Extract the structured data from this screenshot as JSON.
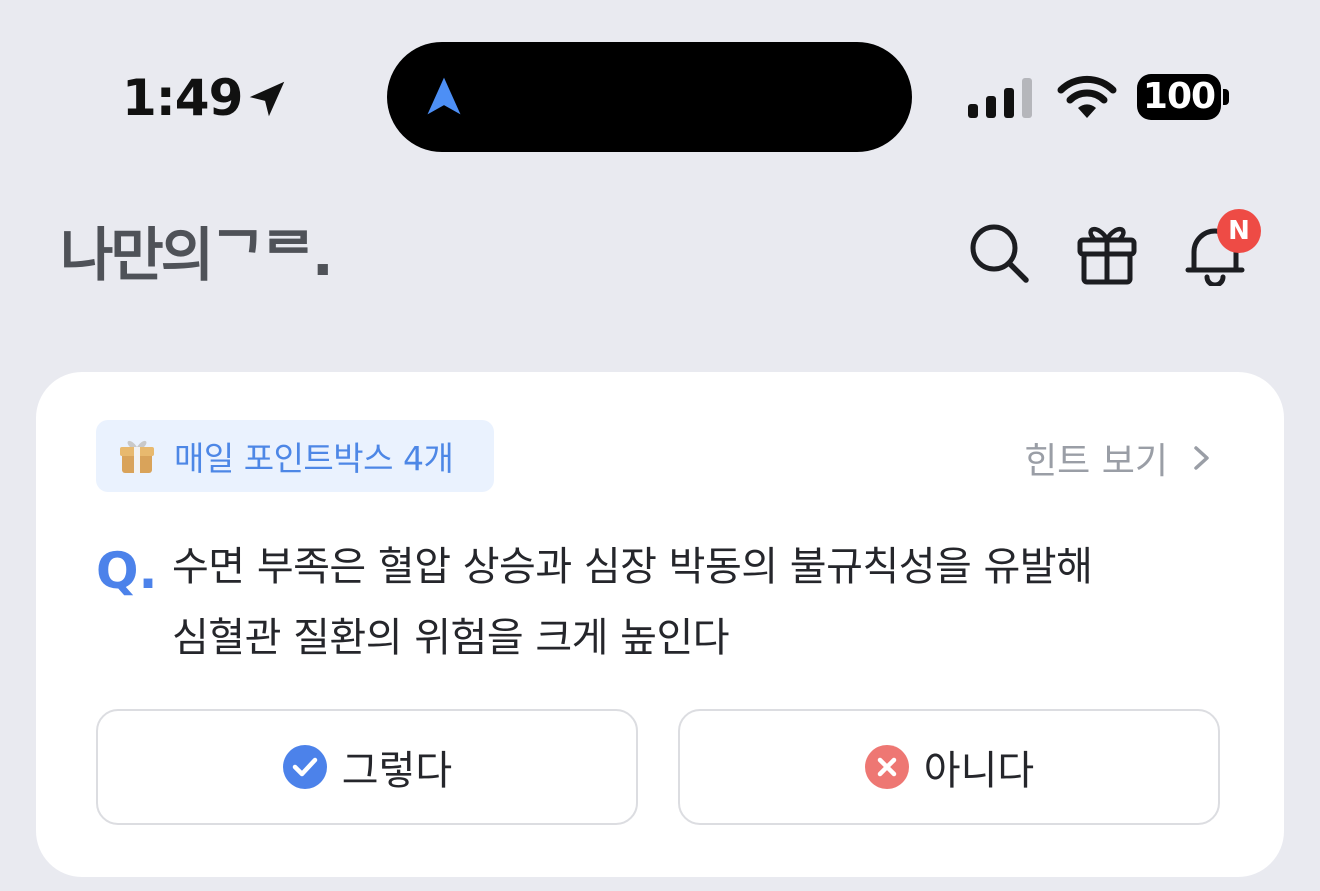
{
  "status_bar": {
    "time": "1:49",
    "battery": "100",
    "icons": [
      "location-arrow-icon",
      "navigation-icon",
      "cellular-signal-icon",
      "wifi-icon",
      "battery-icon"
    ]
  },
  "header": {
    "logo": "나만의ᄀᄅ.",
    "icons": [
      "search-icon",
      "gift-icon",
      "bell-icon"
    ],
    "notification_badge": "N"
  },
  "quiz": {
    "points_pill": "매일 포인트박스 4개",
    "hint_label": "힌트 보기",
    "q_label": "Q.",
    "question_line1": "수면 부족은 혈압 상승과 심장 박동의 불규칙성을 유발해",
    "question_line2": "심혈관 질환의 위험을 크게 높인다",
    "yes_label": "그렇다",
    "no_label": "아니다"
  },
  "colors": {
    "background": "#e9eaf0",
    "accent_blue": "#4c82ea",
    "badge_red": "#ee4b45",
    "no_red": "#ee7773"
  }
}
